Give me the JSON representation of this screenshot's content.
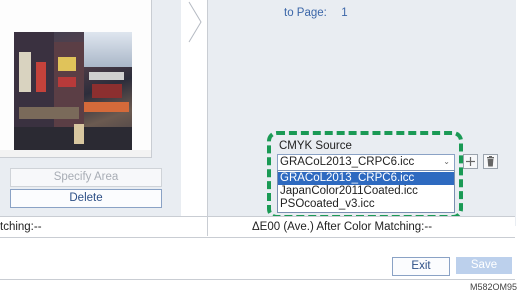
{
  "preview": {
    "specify_area_label": "Specify Area",
    "delete_label": "Delete"
  },
  "right": {
    "to_page_label": "to Page:",
    "to_page_value": "1"
  },
  "cmyk": {
    "label": "CMYK Source",
    "selected": "GRACoL2013_CRPC6.icc",
    "options": [
      "GRACoL2013_CRPC6.icc",
      "JapanColor2011Coated.icc",
      "PSOcoated_v3.icc"
    ],
    "highlighted_option": "GRACoL2013_CRPC6.icc"
  },
  "status": {
    "left_text": "tching:--",
    "right_text": "ΔE00 (Ave.) After Color Matching:--"
  },
  "footer": {
    "exit_label": "Exit",
    "save_label": "Save",
    "model_code": "M582OM95"
  },
  "colors": {
    "highlight": "#1a9a55",
    "selection": "#2e6ac0",
    "accent_text": "#3b66a8"
  },
  "icons": {
    "add": "plus-icon",
    "delete": "trash-icon",
    "dropdown": "chevron-down-icon",
    "panel_arrow": "chevron-right-icon"
  }
}
